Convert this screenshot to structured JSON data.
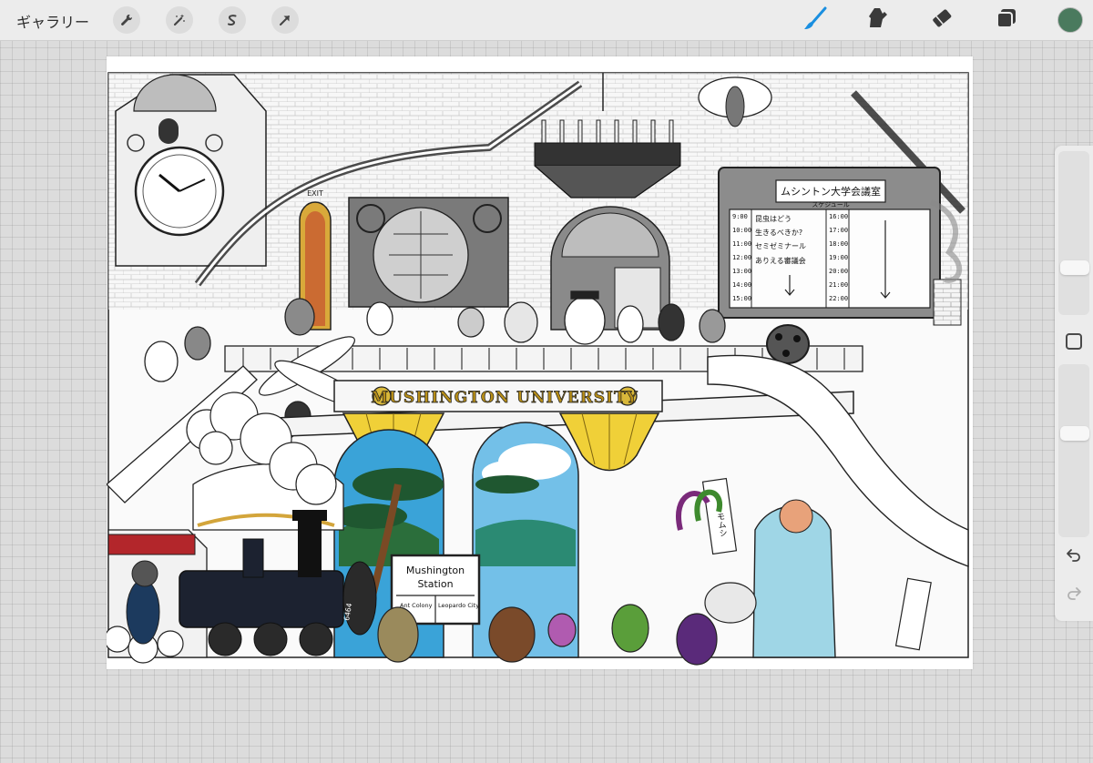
{
  "toolbar": {
    "gallery_label": "ギャラリー",
    "left_tools": [
      "wrench-icon",
      "magic-wand-icon",
      "selection-icon",
      "transform-icon"
    ],
    "right_tools": [
      "brush-icon",
      "smudge-icon",
      "eraser-icon",
      "layers-icon"
    ],
    "active_tool": "brush",
    "active_color": "#4a7a5e",
    "accent_color": "#1a8fe0"
  },
  "artwork": {
    "banner_text": "MUSHINGTON UNIVERSITY",
    "board_title": "ムシントン大学会議室",
    "board_subtitle": "スケジュール",
    "schedule_left_times": [
      "9:00",
      "10:00",
      "11:00",
      "12:00",
      "13:00",
      "14:00",
      "15:00"
    ],
    "schedule_right_times": [
      "16:00",
      "17:00",
      "18:00",
      "19:00",
      "20:00",
      "21:00",
      "22:00"
    ],
    "schedule_items": [
      "昆虫はどう",
      "生きるべきか?",
      "セミゼミナール",
      "ありえる審議会"
    ],
    "exit_sign": "EXIT",
    "station_sign_line1": "Mushington",
    "station_sign_line2": "Station",
    "station_left_dest": "Ant Colony",
    "station_right_dest": "Leopardo City",
    "locomotive_number": "6464",
    "vertical_sign": "イモムシ"
  },
  "sidebar": {
    "brush_size": 0.28,
    "brush_opacity": 0.62,
    "undo_icon": "undo-icon",
    "redo_icon": "redo-icon"
  }
}
